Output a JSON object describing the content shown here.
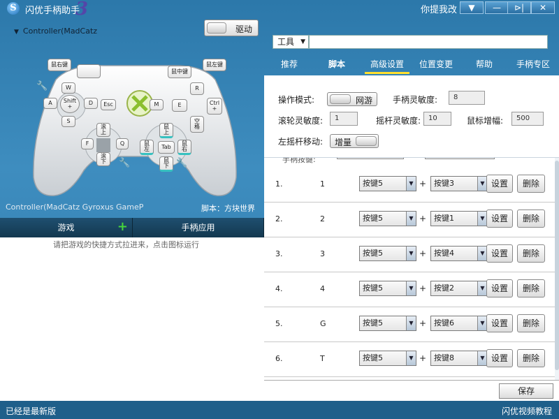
{
  "app": {
    "title": "闪优手柄助手",
    "logo_letter": "S",
    "logo_suffix": "3",
    "feedback": "你提我改"
  },
  "window_controls": [
    "▼",
    "—",
    "⊳|",
    "✕"
  ],
  "left": {
    "controller_select": "Controller(MadCatz",
    "drive_label": "驱动",
    "controller_name": "Controller(MadCatz Gyroxus GameP",
    "script_label": "脚本：方块世界",
    "tabs": [
      "游戏",
      "手柄应用"
    ],
    "hint": "请把游戏的快捷方式拉进来，点击图标运行"
  },
  "gamepad": {
    "lb": "鼠右键",
    "lb_blank": "",
    "rb": "鼠中键",
    "rt": "鼠左键",
    "w": "W",
    "a": "A",
    "d": "D",
    "s": "S",
    "shift": "Shift\n+",
    "esc": "Esc",
    "m": "M",
    "e": "E",
    "r": "R",
    "ctrl": "Ctrl\n+",
    "space": "空\n格",
    "up": "滚\n上",
    "down": "滚\n下",
    "f": "F",
    "q": "Q",
    "m_up": "鼠\n上",
    "m_down": "鼠\n下",
    "m_left": "鼠\n左",
    "m_right": "鼠\n右",
    "tab": "Tab",
    "wrench": "🔧"
  },
  "toolbar": {
    "tools_label": "工具"
  },
  "tabs": [
    "推荐",
    "脚本",
    "高级设置",
    "位置变更",
    "帮助",
    "手柄专区"
  ],
  "settings": {
    "mode_label": "操作模式:",
    "mode_value": "网游",
    "sensitivity_label": "手柄灵敏度:",
    "sensitivity_value": "8",
    "wheel_label": "滚轮灵敏度:",
    "wheel_value": "1",
    "stick_label": "摇杆灵敏度:",
    "stick_value": "10",
    "mouse_gain_label": "鼠标增幅:",
    "mouse_gain_value": "500",
    "left_stick_label": "左摇杆移动:",
    "left_stick_value": "增量"
  },
  "mapping": {
    "partial_header": "手柄按键:",
    "rows": [
      {
        "no": "1.",
        "key": "1",
        "a": "按键5",
        "b": "按键3"
      },
      {
        "no": "2.",
        "key": "2",
        "a": "按键5",
        "b": "按键1"
      },
      {
        "no": "3.",
        "key": "3",
        "a": "按键5",
        "b": "按键4"
      },
      {
        "no": "4.",
        "key": "4",
        "a": "按键5",
        "b": "按键2"
      },
      {
        "no": "5.",
        "key": "G",
        "a": "按键5",
        "b": "按键6"
      },
      {
        "no": "6.",
        "key": "T",
        "a": "按键5",
        "b": "按键8"
      }
    ],
    "plus": "+",
    "set_label": "设置",
    "delete_label": "删除"
  },
  "save_label": "保存",
  "status": {
    "left": "已经是最新版",
    "right": "闪优视频教程"
  }
}
